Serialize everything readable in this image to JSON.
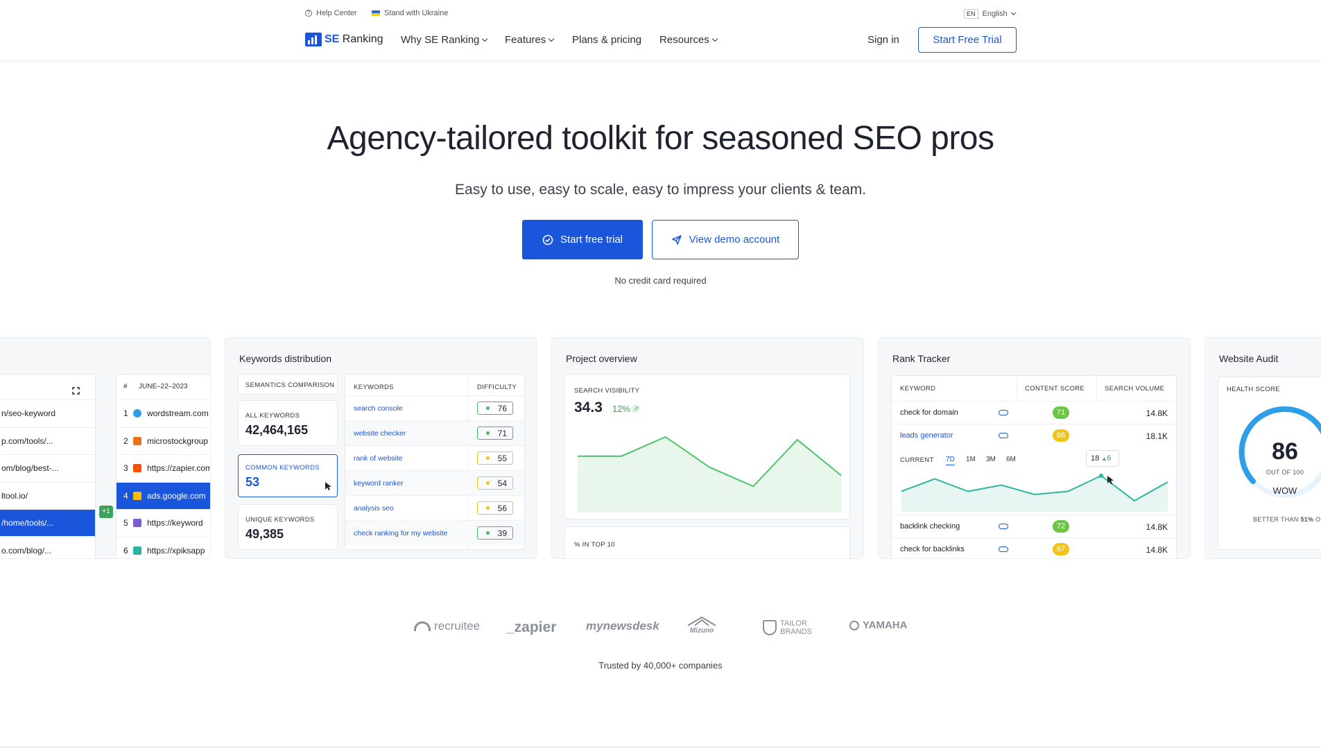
{
  "util": {
    "help": "Help Center",
    "ukraine": "Stand with Ukraine",
    "lang_code": "EN",
    "lang": "English"
  },
  "nav": {
    "logo_se": "SE",
    "logo_ranking": "Ranking",
    "items": [
      "Why SE Ranking",
      "Features",
      "Plans & pricing",
      "Resources"
    ],
    "sign_in": "Sign in",
    "start_trial": "Start Free Trial"
  },
  "hero": {
    "title": "Agency-tailored toolkit for seasoned SEO pros",
    "subtitle": "Easy to use, easy to scale, easy to impress your clients & team.",
    "cta_primary": "Start free trial",
    "cta_secondary": "View demo account",
    "note": "No credit card required"
  },
  "competitors": {
    "date_header": "JUNE–22–2023",
    "hash": "#",
    "left_urls": [
      "n/seo-keyword",
      "p.com/tools/...",
      "om/blog/best-...",
      "ltool.io/",
      "/home/tools/...",
      "o.com/blog/..."
    ],
    "rows": [
      {
        "n": "1",
        "site": "wordstream.com"
      },
      {
        "n": "2",
        "site": "microstockgroup"
      },
      {
        "n": "3",
        "site": "https://zapier.com"
      },
      {
        "n": "4",
        "site": "ads.google.com"
      },
      {
        "n": "5",
        "site": "https://keyword"
      },
      {
        "n": "6",
        "site": "https://xpiksapp"
      }
    ],
    "badge": "+1"
  },
  "keywords_distribution": {
    "title": "Keywords distribution",
    "semantics": "SEMANTICS COMPARISON",
    "all_label": "ALL KEYWORDS",
    "all_value": "42,464,165",
    "common_label": "COMMON KEYWORDS",
    "common_value": "53",
    "unique_label": "UNIQUE KEYWORDS",
    "unique_value": "49,385",
    "col_keywords": "KEYWORDS",
    "col_difficulty": "DIFFICULTY",
    "rows": [
      {
        "kw": "search console",
        "d": "76",
        "color": "#47b864"
      },
      {
        "kw": "website checker",
        "d": "71",
        "color": "#47b864"
      },
      {
        "kw": "rank of website",
        "d": "55",
        "color": "#f0c419"
      },
      {
        "kw": "keyword ranker",
        "d": "54",
        "color": "#f0c419"
      },
      {
        "kw": "analysis seo",
        "d": "56",
        "color": "#f0c419"
      },
      {
        "kw": "check ranking for my website",
        "d": "39",
        "color": "#47b864"
      }
    ]
  },
  "project_overview": {
    "title": "Project overview",
    "visibility_label": "SEARCH VISIBILITY",
    "visibility_value": "34.3",
    "visibility_change": "12%",
    "top10_label": "% IN TOP 10",
    "chart_data": {
      "type": "area",
      "values": [
        8,
        8,
        15,
        4,
        -3,
        14,
        1
      ]
    }
  },
  "rank_tracker": {
    "title": "Rank Tracker",
    "col_keyword": "KEYWORD",
    "col_content": "CONTENT SCORE",
    "col_volume": "SEARCH VOLUME",
    "rows_top": [
      {
        "kw": "check for domain",
        "score": "71",
        "vol": "14.8K",
        "color": "#6cc644",
        "link": false
      },
      {
        "kw": "leads generator",
        "score": "66",
        "vol": "18.1K",
        "color": "#f0c419",
        "link": true
      }
    ],
    "rows_bottom": [
      {
        "kw": "backlink checking",
        "score": "72",
        "vol": "14.8K",
        "color": "#6cc644"
      },
      {
        "kw": "check for backlinks",
        "score": "67",
        "vol": "14.8K",
        "color": "#f0c419"
      }
    ],
    "current_label": "CURRENT",
    "periods": [
      "7D",
      "1M",
      "3M",
      "6M"
    ],
    "tooltip_value": "18",
    "tooltip_delta": "6",
    "chart_data": {
      "type": "line",
      "values": [
        18,
        22,
        18,
        20,
        17,
        18,
        23,
        15,
        21
      ]
    }
  },
  "website_audit": {
    "title": "Website Audit",
    "health_label": "HEALTH SCORE",
    "score": "86",
    "out_of": "OUT OF 100",
    "wow": "WOW",
    "better_prefix": "BETTER THAN ",
    "better_pct": "51%",
    "better_suffix": " OF US"
  },
  "trusted": {
    "logos": [
      "recruitee",
      "_zapier",
      "mynewsdesk",
      "Mizuno",
      "TAILOR BRANDS",
      "YAMAHA"
    ],
    "text": "Trusted by 40,000+ companies"
  }
}
